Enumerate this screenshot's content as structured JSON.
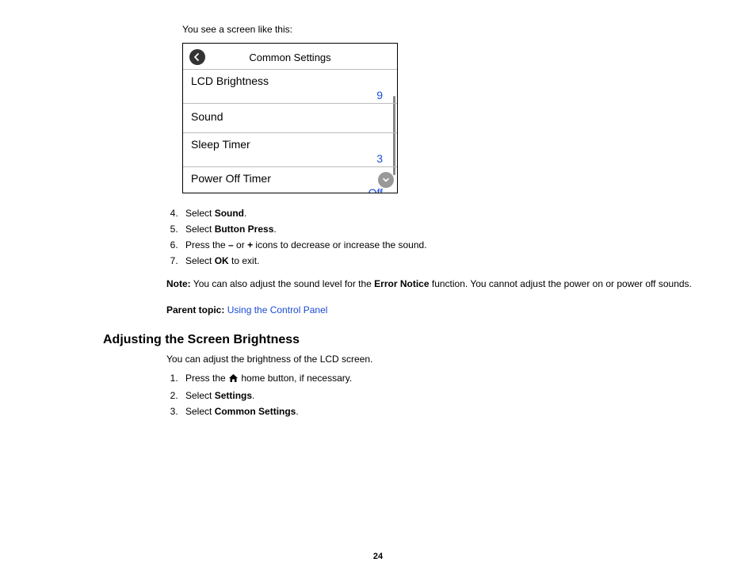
{
  "intro": "You see a screen like this:",
  "screenshot": {
    "title": "Common Settings",
    "items": [
      {
        "label": "LCD Brightness",
        "value": "9"
      },
      {
        "label": "Sound",
        "value": ""
      },
      {
        "label": "Sleep Timer",
        "value": "3"
      },
      {
        "label": "Power Off Timer",
        "value": "Off"
      }
    ]
  },
  "steps1": {
    "start": 4,
    "items": [
      {
        "pre": "Select ",
        "bold": "Sound",
        "post": "."
      },
      {
        "pre": "Select ",
        "bold": "Button Press",
        "post": "."
      },
      {
        "pre": "Press the ",
        "bold": "–",
        "mid": " or ",
        "bold2": "+",
        "post": " icons to decrease or increase the sound."
      },
      {
        "pre": "Select ",
        "bold": "OK",
        "post": " to exit."
      }
    ]
  },
  "note": {
    "label": "Note:",
    "pre": " You can also adjust the sound level for the ",
    "bold": "Error Notice",
    "post": " function. You cannot adjust the power on or power off sounds."
  },
  "parentTopic": {
    "label": "Parent topic:",
    "link": "Using the Control Panel"
  },
  "heading2": "Adjusting the Screen Brightness",
  "intro2": "You can adjust the brightness of the LCD screen.",
  "steps2": {
    "start": 1,
    "items": [
      {
        "pre": "Press the ",
        "icon": "home",
        "post": " home button, if necessary."
      },
      {
        "pre": "Select ",
        "bold": "Settings",
        "post": "."
      },
      {
        "pre": "Select ",
        "bold": "Common Settings",
        "post": "."
      }
    ]
  },
  "pageNumber": "24"
}
